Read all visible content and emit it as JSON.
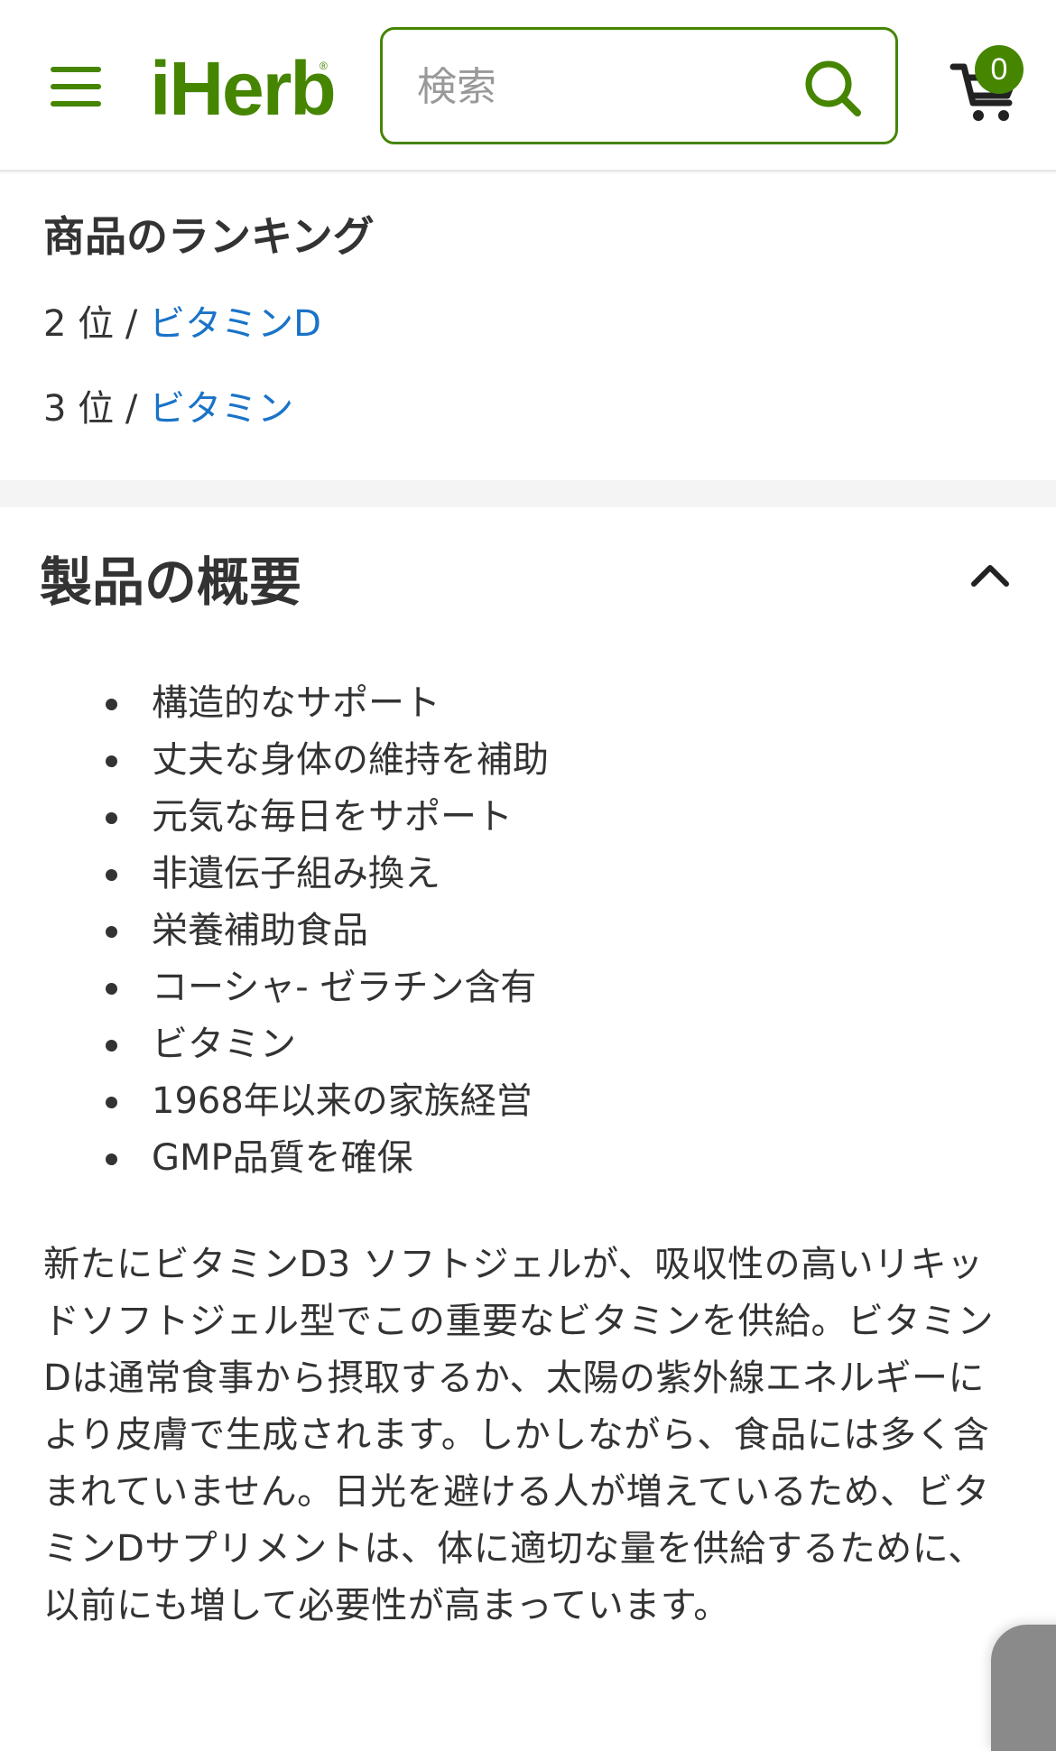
{
  "header": {
    "logo": "iHerb",
    "logo_mark": "®",
    "search_placeholder": "検索",
    "cart_count": "0"
  },
  "icons": {
    "menu": "hamburger-menu-icon",
    "search": "search-icon",
    "cart": "cart-icon",
    "collapse": "chevron-up-icon"
  },
  "colors": {
    "brand_green": "#458500",
    "link_blue": "#1a73c8",
    "text": "#333333"
  },
  "ranking": {
    "title": "商品のランキング",
    "items": [
      {
        "rank": "2 位 / ",
        "category": "ビタミンD"
      },
      {
        "rank": "3 位 / ",
        "category": "ビタミン"
      }
    ]
  },
  "overview": {
    "title": "製品の概要",
    "bullets": [
      "構造的なサポート",
      "丈夫な身体の維持を補助",
      "元気な毎日をサポート",
      "非遺伝子組み換え",
      "栄養補助食品",
      "コーシャ- ゼラチン含有",
      "ビタミン",
      "1968年以来の家族経営",
      "GMP品質を確保"
    ],
    "description": "新たにビタミンD3 ソフトジェルが、吸収性の高いリキッドソフトジェル型でこの重要なビタミンを供給。ビタミンDは通常食事から摂取するか、太陽の紫外線エネルギーにより皮膚で生成されます。しかしながら、食品には多く含まれていません。日光を避ける人が増えているため、ビタミンDサプリメントは、体に適切な量を供給するために、以前にも増して必要性が高まっています。"
  }
}
